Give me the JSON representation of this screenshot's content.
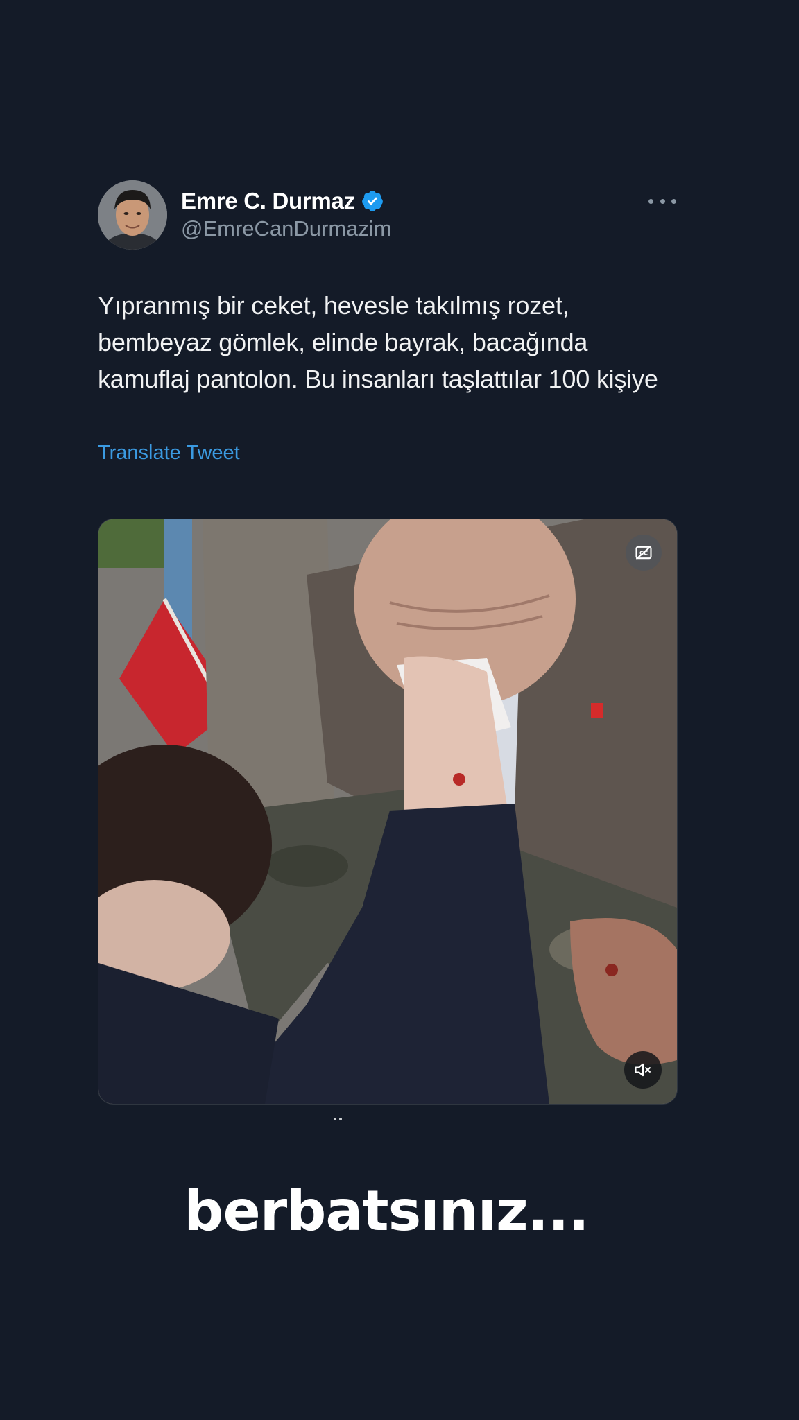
{
  "tweet": {
    "display_name": "Emre C. Durmaz",
    "handle": "@EmreCanDurmazim",
    "verified": true,
    "text": "Yıpranmış bir ceket, hevesle takılmış rozet, bembeyaz gömlek, elinde bayrak, bacağında kamuflaj pantolon. Bu insanları taşlattılar 100 kişiye",
    "translate_label": "Translate Tweet"
  },
  "media": {
    "type": "video",
    "captions_icon": "captions-off-icon",
    "mute_icon": "speaker-muted-icon"
  },
  "overlay_caption": "berbatsınız...",
  "colors": {
    "background": "#141b28",
    "link": "#3b9ae1",
    "verified": "#1d9bf0",
    "secondary_text": "#8b98a5"
  }
}
